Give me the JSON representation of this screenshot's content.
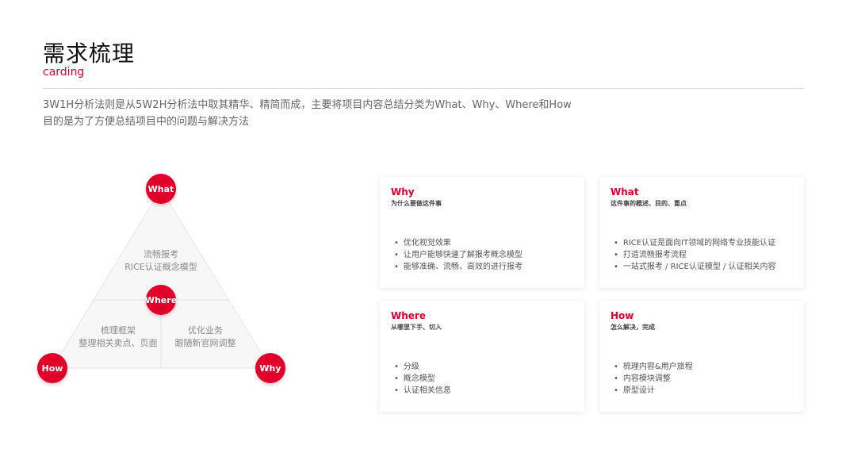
{
  "header": {
    "title": "需求梳理",
    "subtitle": "carding",
    "description_lines": [
      "3W1H分析法则是从5W2H分析法中取其精华、精简而成，主要将项目内容总结分类为What、Why、Where和How",
      "目的是为了方便总结项目中的问题与解决方法"
    ]
  },
  "diagram": {
    "nodes": {
      "top": "What",
      "center": "Where",
      "left": "How",
      "right": "Why"
    },
    "top_zone": [
      "流畅报考",
      "RICE认证概念模型"
    ],
    "left_zone": [
      "梳理框架",
      "整理相关卖点、页面"
    ],
    "right_zone": [
      "优化业务",
      "跟随新官网调整"
    ]
  },
  "cards": [
    {
      "title": "Why",
      "subtitle": "为什么要做这件事",
      "items": [
        "优化视觉效果",
        "让用户能够快速了解报考概念模型",
        "能够准确、流畅、高效的进行报考"
      ]
    },
    {
      "title": "What",
      "subtitle": "这件事的概述、目的、重点",
      "items": [
        "RICE认证是面向IT领域的网络专业技能认证",
        "打造流畅报考流程",
        "一站式报考 / RICE认证模型 / 认证相关内容"
      ]
    },
    {
      "title": "Where",
      "subtitle": "从哪里下手、切入",
      "items": [
        "分级",
        "概念模型",
        "认证相关信息"
      ]
    },
    {
      "title": "How",
      "subtitle": "怎么解决，完成",
      "items": [
        "梳理内容&用户旅程",
        "内容模块调整",
        "原型设计"
      ]
    }
  ],
  "colors": {
    "accent": "#e0002a",
    "text": "#333333",
    "muted": "#8a8a8a"
  }
}
